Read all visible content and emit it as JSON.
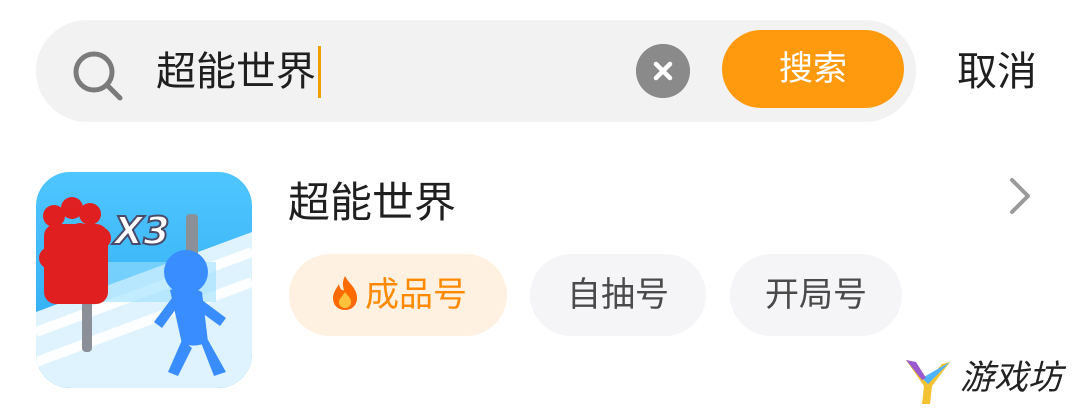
{
  "search": {
    "query": "超能世界",
    "search_button_label": "搜索",
    "cancel_label": "取消"
  },
  "result": {
    "title": "超能世界",
    "icon_overlay_text": "X3",
    "tags": [
      {
        "label": "成品号",
        "icon": "fire-icon"
      },
      {
        "label": "自抽号"
      },
      {
        "label": "开局号"
      }
    ]
  },
  "watermark": {
    "text": "游戏坊"
  },
  "colors": {
    "accent": "#ff9a0f",
    "caret": "#f0a000",
    "search_bg": "#f2f2f2",
    "tag_highlight_bg": "#fff1e2",
    "tag_highlight_text": "#ff8a00",
    "tag_bg": "#f5f5f8"
  }
}
